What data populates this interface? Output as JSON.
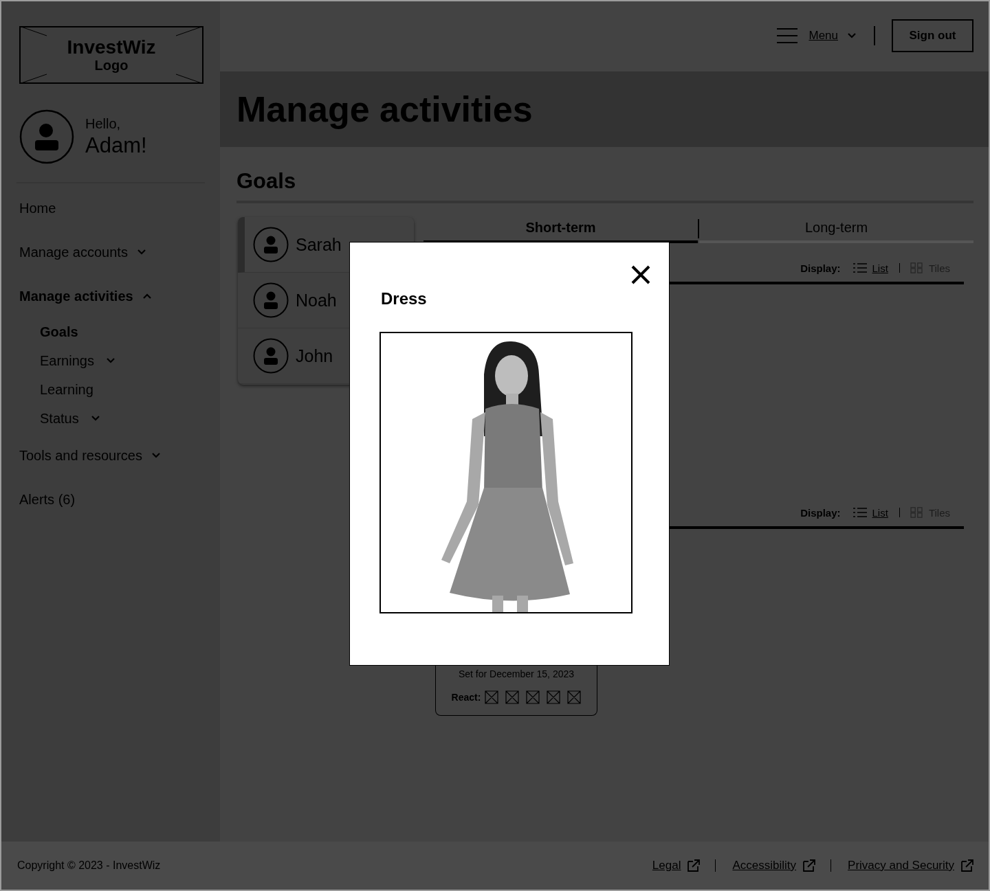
{
  "logo": {
    "name": "InvestWiz",
    "caption": "Logo"
  },
  "user": {
    "greeting": "Hello,",
    "name": "Adam!"
  },
  "nav": [
    {
      "label": "Home",
      "selected": false
    },
    {
      "label": "Manage accounts",
      "selected": false,
      "expanded": false
    },
    {
      "label": "Manage activities",
      "selected": true,
      "expanded": true,
      "children": [
        {
          "label": "Goals",
          "selected": true
        },
        {
          "label": "Earnings",
          "selected": false,
          "expanded": false
        },
        {
          "label": "Learning",
          "selected": false
        },
        {
          "label": "Status",
          "selected": false,
          "expanded": false
        }
      ]
    },
    {
      "label": "Tools and resources",
      "selected": false,
      "expanded": false
    },
    {
      "label": "Alerts (6)",
      "selected": false
    }
  ],
  "header": {
    "menu": "Menu",
    "sign_out": "Sign out"
  },
  "page_title": "Manage activities",
  "section_title": "Goals",
  "people": [
    {
      "name": "Sarah",
      "selected": true
    },
    {
      "name": "Noah",
      "selected": false
    },
    {
      "name": "John",
      "selected": false
    }
  ],
  "tabs": [
    {
      "label": "Short-term",
      "selected": true
    },
    {
      "label": "Long-term",
      "selected": false
    }
  ],
  "displays": [
    {
      "label": "Display:",
      "options": [
        {
          "label": "List",
          "kind": "list",
          "selected": true
        },
        {
          "label": "Tiles",
          "kind": "tiles",
          "selected": false
        }
      ]
    },
    {
      "label": "Display:",
      "options": [
        {
          "label": "List",
          "kind": "list",
          "selected": true
        },
        {
          "label": "Tiles",
          "kind": "tiles",
          "selected": false
        }
      ]
    }
  ],
  "goal_card": {
    "date": "Set for December 15, 2023",
    "react_label": "React:"
  },
  "modal": {
    "title": "Dress"
  },
  "footer": {
    "copyright": "Copyright © 2023 - InvestWiz",
    "links": [
      "Legal",
      "Accessibility",
      "Privacy and Security"
    ]
  }
}
